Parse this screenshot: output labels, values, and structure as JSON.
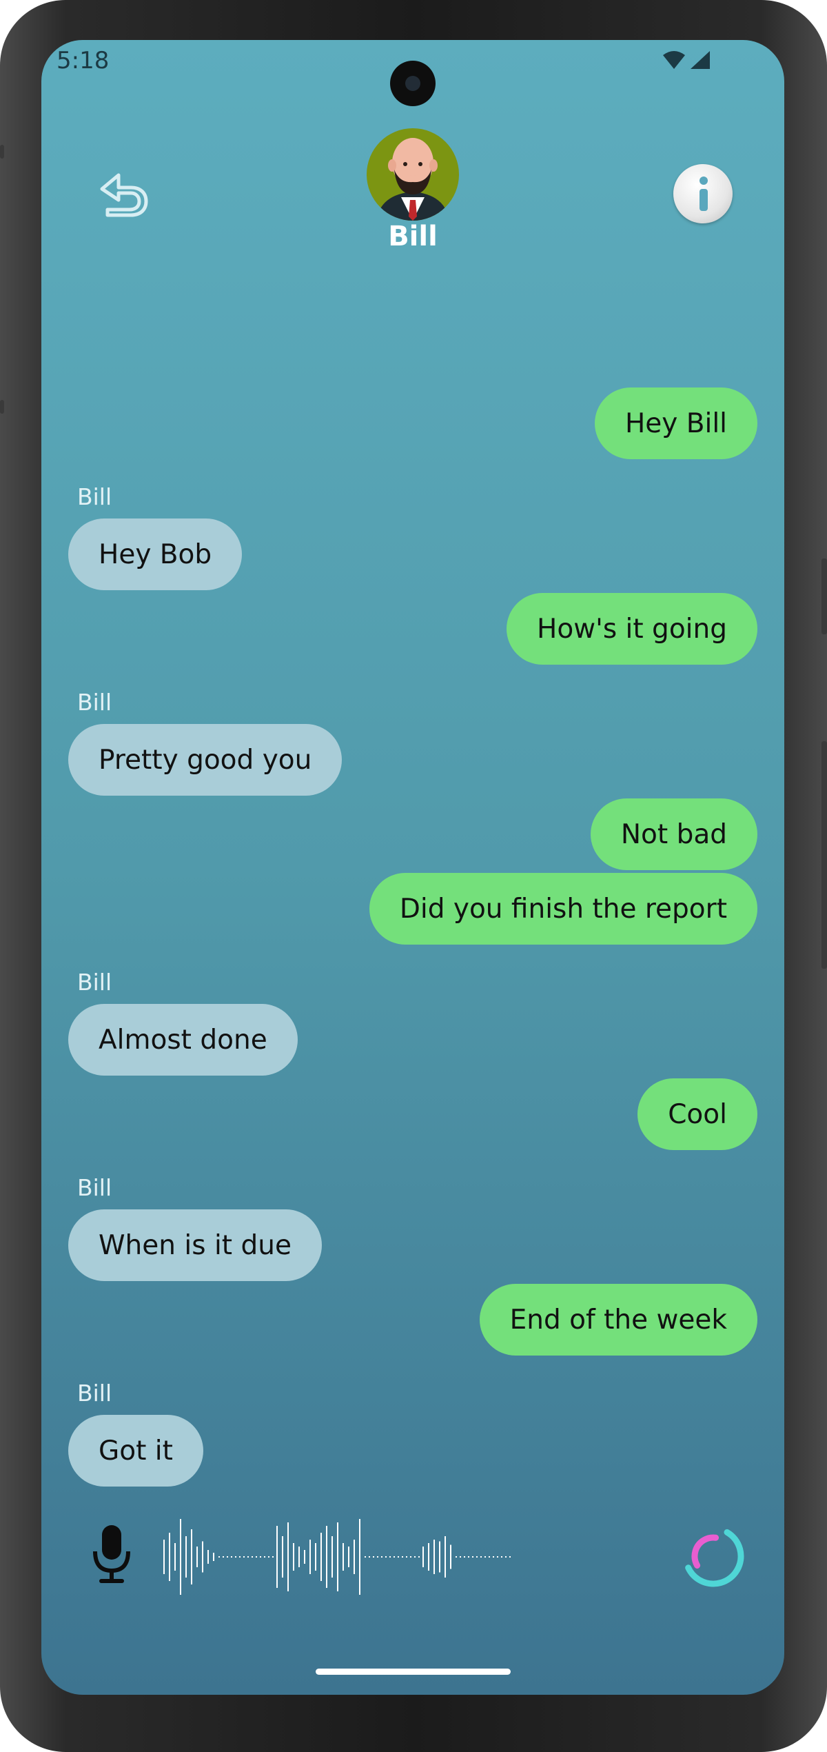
{
  "status_bar": {
    "time": "5:18"
  },
  "header": {
    "contact_name": "Bill",
    "icons": {
      "back": "undo-arrow-icon",
      "info": "info-icon",
      "avatar": "bald-man-avatar"
    }
  },
  "messages": [
    {
      "from": "me",
      "text": "Hey Bill"
    },
    {
      "from": "Bill",
      "sender_label": "Bill",
      "text": "Hey Bob"
    },
    {
      "from": "me",
      "text": "How's it going"
    },
    {
      "from": "Bill",
      "sender_label": "Bill",
      "text": "Pretty good you"
    },
    {
      "from": "me",
      "text": "Not bad"
    },
    {
      "from": "me",
      "text": "Did you finish the report"
    },
    {
      "from": "Bill",
      "sender_label": "Bill",
      "text": "Almost done"
    },
    {
      "from": "me",
      "text": "Cool"
    },
    {
      "from": "Bill",
      "sender_label": "Bill",
      "text": "When is it due"
    },
    {
      "from": "me",
      "text": "End of the week"
    },
    {
      "from": "Bill",
      "sender_label": "Bill",
      "text": "Got it"
    }
  ],
  "input_bar": {
    "icons": {
      "mic": "microphone-icon",
      "waveform": "audio-waveform",
      "spinner": "loading-spinner-icon"
    }
  },
  "colors": {
    "background_top": "#5dadbe",
    "background_bottom": "#3d7490",
    "outgoing_bubble": "#74e07b",
    "incoming_bubble": "#a9cdd8",
    "spinner_cyan": "#4fd6d6",
    "spinner_pink": "#e85ed0"
  }
}
